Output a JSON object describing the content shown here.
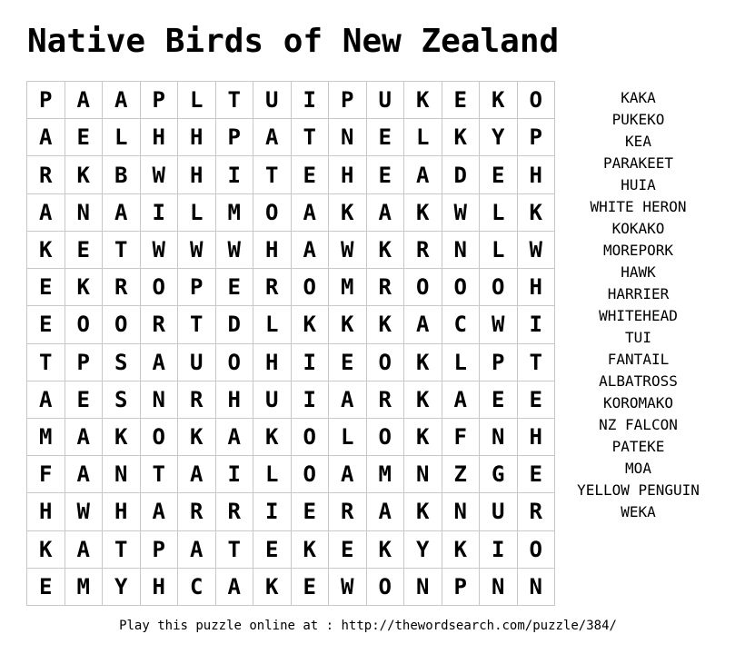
{
  "title": "Native Birds of New Zealand",
  "grid": [
    [
      "P",
      "A",
      "A",
      "P",
      "L",
      "T",
      "U",
      "I",
      "P",
      "U",
      "K",
      "E",
      "K",
      "O"
    ],
    [
      "A",
      "E",
      "L",
      "H",
      "H",
      "P",
      "A",
      "T",
      "N",
      "E",
      "L",
      "K",
      "Y",
      "P"
    ],
    [
      "R",
      "K",
      "B",
      "W",
      "H",
      "I",
      "T",
      "E",
      "H",
      "E",
      "A",
      "D",
      "E",
      "H"
    ],
    [
      "A",
      "N",
      "A",
      "I",
      "L",
      "M",
      "O",
      "A",
      "K",
      "A",
      "K",
      "W",
      "L",
      "K"
    ],
    [
      "K",
      "E",
      "T",
      "W",
      "W",
      "W",
      "H",
      "A",
      "W",
      "K",
      "R",
      "N",
      "L",
      "W"
    ],
    [
      "E",
      "K",
      "R",
      "O",
      "P",
      "E",
      "R",
      "O",
      "M",
      "R",
      "O",
      "O",
      "O",
      "H"
    ],
    [
      "E",
      "O",
      "O",
      "R",
      "T",
      "D",
      "L",
      "K",
      "K",
      "K",
      "A",
      "C",
      "W",
      "I"
    ],
    [
      "T",
      "P",
      "S",
      "A",
      "U",
      "O",
      "H",
      "I",
      "E",
      "O",
      "K",
      "L",
      "P",
      "T"
    ],
    [
      "A",
      "E",
      "S",
      "N",
      "R",
      "H",
      "U",
      "I",
      "A",
      "R",
      "K",
      "A",
      "E",
      "E"
    ],
    [
      "M",
      "A",
      "K",
      "O",
      "K",
      "A",
      "K",
      "O",
      "L",
      "O",
      "K",
      "F",
      "N",
      "H"
    ],
    [
      "F",
      "A",
      "N",
      "T",
      "A",
      "I",
      "L",
      "O",
      "A",
      "M",
      "N",
      "Z",
      "G",
      "E"
    ],
    [
      "H",
      "W",
      "H",
      "A",
      "R",
      "R",
      "I",
      "E",
      "R",
      "A",
      "K",
      "N",
      "U",
      "R"
    ],
    [
      "K",
      "A",
      "T",
      "P",
      "A",
      "T",
      "E",
      "K",
      "E",
      "K",
      "Y",
      "K",
      "I",
      "O"
    ],
    [
      "E",
      "M",
      "Y",
      "H",
      "C",
      "A",
      "K",
      "E",
      "W",
      "O",
      "N",
      "P",
      "N",
      "N"
    ]
  ],
  "words": [
    "KAKA",
    "PUKEKO",
    "KEA",
    "PARAKEET",
    "HUIA",
    "WHITE HERON",
    "KOKAKO",
    "MOREPORK",
    "HAWK",
    "HARRIER",
    "WHITEHEAD",
    "TUI",
    "FANTAIL",
    "ALBATROSS",
    "KOROMAKO",
    "NZ FALCON",
    "PATEKE",
    "MOA",
    "YELLOW PENGUIN",
    "WEKA"
  ],
  "footer": "Play this puzzle online at : http://thewordsearch.com/puzzle/384/"
}
